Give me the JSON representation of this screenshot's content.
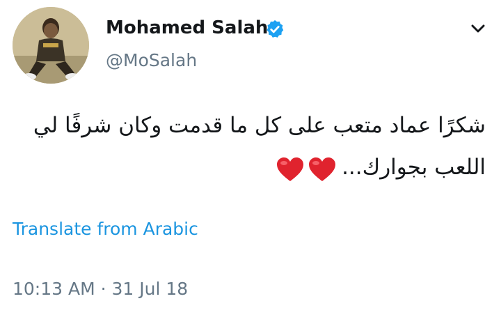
{
  "tweet": {
    "author": {
      "display_name": "Mohamed Salah",
      "handle": "@MoSalah",
      "verified": true,
      "verified_icon": "verified-badge-icon",
      "avatar": "profile-photo"
    },
    "menu_icon": "chevron-down-icon",
    "text_lines": [
      "شكرًا عماد متعب على كل ما قدمت وكان شرفًا لي",
      "اللعب بجوارك..."
    ],
    "emoji": [
      "heart-icon",
      "heart-icon"
    ],
    "translate_label": "Translate from Arabic",
    "timestamp": "10:13 AM · 31 Jul 18"
  },
  "colors": {
    "text": "#14171a",
    "secondary": "#657786",
    "link": "#1b95e0",
    "verified": "#1da1f2",
    "heart": "#e0232e"
  }
}
